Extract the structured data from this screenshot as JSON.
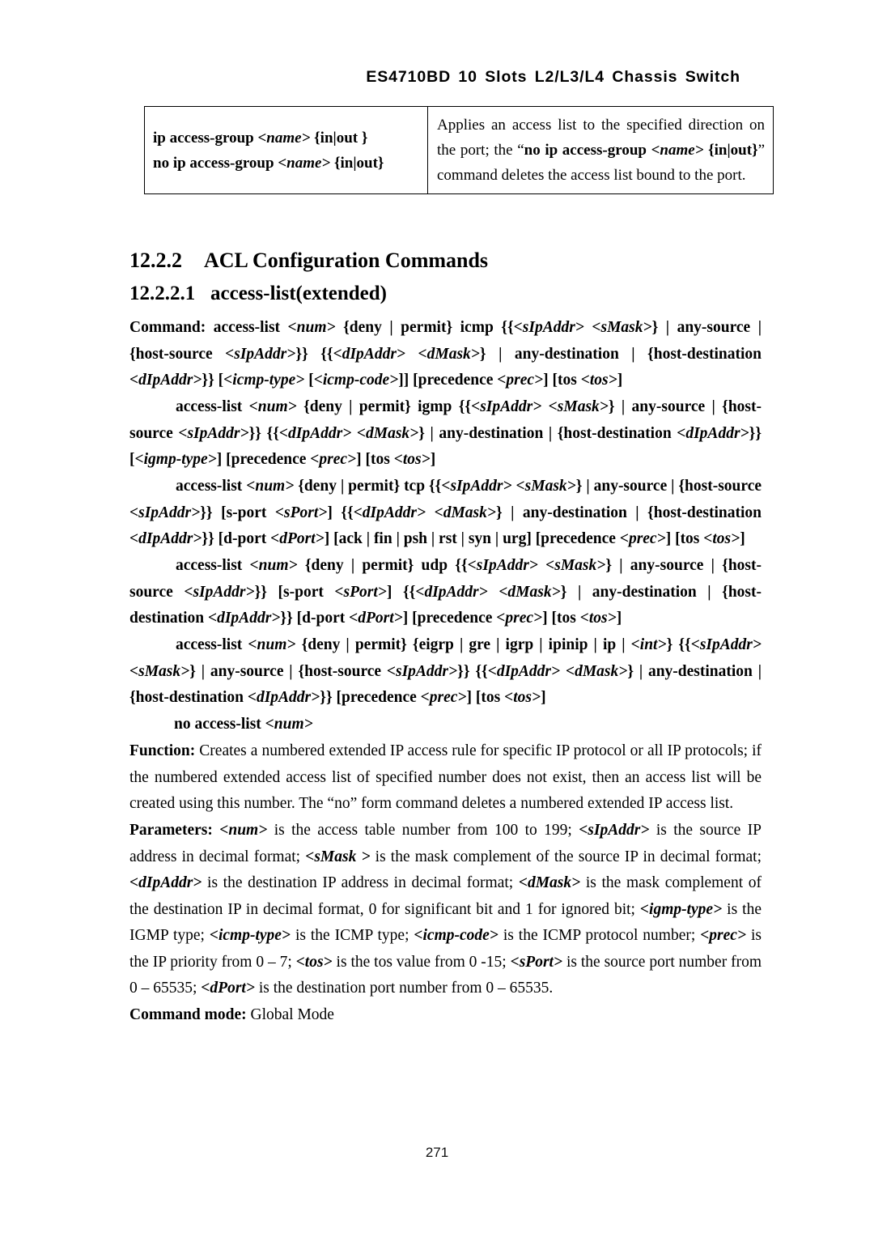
{
  "header": {
    "running_title": "ES4710BD 10 Slots L2/L3/L4 Chassis Switch"
  },
  "command_table": {
    "rows": [
      {
        "command_lines": [
          "ip access-group <name> {in|out }",
          "no ip access-group <name> {in|out}"
        ],
        "description": "Applies an access list to the specified direction on the port; the “no ip access-group <name> {in|out}” command deletes the access list bound to the port."
      }
    ]
  },
  "sections": {
    "h2_number": "12.2.2",
    "h2_title": "ACL Configuration Commands",
    "h3_number": "12.2.2.1",
    "h3_title": "access-list(extended)"
  },
  "syntax": {
    "label_command": "Command:",
    "icmp": "access-list <num> {deny | permit} icmp {{<sIpAddr> <sMask>} | any-source | {host-source <sIpAddr>}} {{<dIpAddr> <dMask>} | any-destination | {host-destination <dIpAddr>}} [<icmp-type> [<icmp-code>]] [precedence <prec>] [tos <tos>]",
    "igmp": "access-list <num> {deny | permit} igmp {{<sIpAddr> <sMask>} | any-source | {host-source <sIpAddr>}} {{<dIpAddr> <dMask>} | any-destination | {host-destination <dIpAddr>}} [<igmp-type>] [precedence <prec>] [tos <tos>]",
    "tcp": "access-list <num> {deny | permit} tcp {{<sIpAddr> <sMask>} | any-source | {host-source <sIpAddr>}} [s-port <sPort>] {{<dIpAddr> <dMask>} | any-destination | {host-destination <dIpAddr>}} [d-port <dPort>] [ack | fin | psh | rst | syn | urg] [precedence <prec>] [tos <tos>]",
    "udp": "access-list <num> {deny | permit} udp {{<sIpAddr> <sMask>} | any-source | {host-source <sIpAddr>}} [s-port <sPort>] {{<dIpAddr> <dMask>} | any-destination | {host-destination <dIpAddr>}} [d-port <dPort>] [precedence <prec>] [tos <tos>]",
    "other_protocols": "access-list <num> {deny | permit} {eigrp | gre | igrp | ipinip | ip | <int>} {{<sIpAddr> <sMask>} | any-source | {host-source <sIpAddr>}} {{<dIpAddr> <dMask>} | any-destination | {host-destination <dIpAddr>}} [precedence <prec>] [tos <tos>]",
    "no_form": "no access-list <num>"
  },
  "function": {
    "label": "Function:",
    "text": "Creates a numbered extended IP access rule for specific IP protocol or all IP protocols; if the numbered extended access list of specified number does not exist, then an access list will be created using this number. The “no” form command deletes a numbered extended IP access list."
  },
  "parameters": {
    "label": "Parameters:",
    "text": "<num> is the access table number from 100 to 199; <sIpAddr> is the source IP address in decimal format; <sMask > is the mask complement of the source IP in decimal format; <dIpAddr> is the destination IP address in decimal format; <dMask> is the mask complement of the destination IP in decimal format, 0 for significant bit and 1 for ignored bit; <igmp-type> is the IGMP type; <icmp-type> is the ICMP type; <icmp-code> is the ICMP protocol number; <prec> is the IP priority from 0 – 7; <tos> is the tos value from 0 -15; <sPort> is the source port number from 0 – 65535; <dPort> is the destination port number from 0 – 65535."
  },
  "command_mode": {
    "label": "Command mode:",
    "value": "Global Mode"
  },
  "footer": {
    "page_number": "271"
  }
}
